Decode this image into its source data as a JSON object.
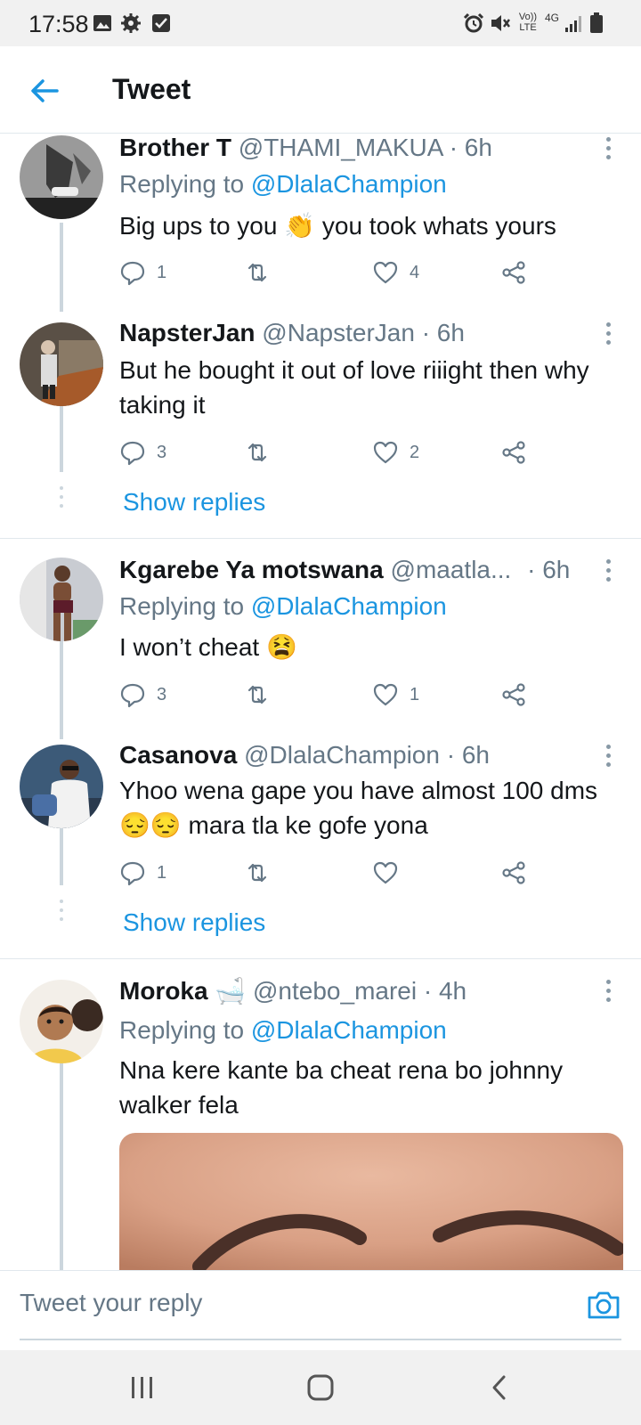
{
  "status_bar": {
    "time": "17:58",
    "network": "4G",
    "volte": "Vo)) LTE",
    "icons": [
      "image-icon",
      "settings-icon",
      "checkbox-icon",
      "alarm-icon",
      "mute-icon",
      "signal-icon",
      "battery-icon"
    ]
  },
  "header": {
    "title": "Tweet",
    "back_icon": "arrow-left-icon"
  },
  "tweets": [
    {
      "name": "Brother T",
      "handle": "@THAMI_MAKUA",
      "time": "· 6h",
      "replying_prefix": "Replying to ",
      "replying_to": "@DlalaChampion",
      "text": "Big ups to you 👏 you took whats yours",
      "replies": "1",
      "retweets": "",
      "likes": "4"
    },
    {
      "name": "NapsterJan",
      "handle": "@NapsterJan",
      "time": "· 6h",
      "text": "But he bought it out of love riiight then why taking it",
      "replies": "3",
      "retweets": "",
      "likes": "2",
      "show_replies": "Show replies"
    },
    {
      "name": "Kgarebe Ya motswana",
      "handle": "@maatla...",
      "time": "· 6h",
      "replying_prefix": "Replying to ",
      "replying_to": "@DlalaChampion",
      "text": "I won’t cheat 😫",
      "replies": "3",
      "retweets": "",
      "likes": "1"
    },
    {
      "name": "Casanova",
      "handle": "@DlalaChampion",
      "time": "· 6h",
      "text": "Yhoo wena gape you have almost 100 dms 😔😔 mara tla ke gofe yona",
      "replies": "1",
      "retweets": "",
      "likes": "",
      "show_replies": "Show replies"
    },
    {
      "name": "Moroka 🛁",
      "handle": "@ntebo_marei",
      "time": "· 4h",
      "replying_prefix": "Replying to ",
      "replying_to": "@DlalaChampion",
      "text": "Nna kere kante ba cheat rena bo johnny walker fela"
    }
  ],
  "reply_bar": {
    "placeholder": "Tweet your reply",
    "camera_icon": "camera-icon"
  },
  "nav_bar": {
    "buttons": [
      "recent-apps-icon",
      "home-icon",
      "back-icon"
    ]
  },
  "colors": {
    "accent": "#1b95e0",
    "muted": "#657786",
    "text": "#14171a",
    "thread_line": "#ccd6dd"
  }
}
